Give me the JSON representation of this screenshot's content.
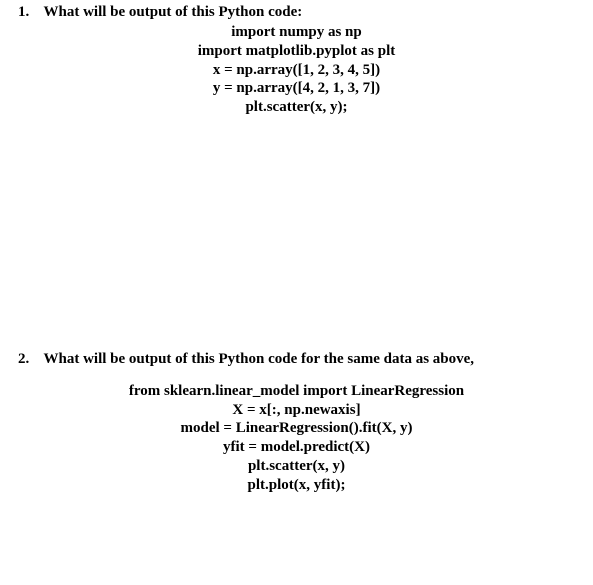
{
  "questions": {
    "q1": {
      "number": "1.",
      "prompt": "What will be output of this Python code:",
      "code": [
        "import numpy as np",
        "import matplotlib.pyplot as plt",
        "x = np.array([1, 2, 3, 4, 5])",
        "y = np.array([4, 2, 1, 3, 7])",
        "plt.scatter(x, y);"
      ]
    },
    "q2": {
      "number": "2.",
      "prompt": "What will be output of this Python code for the same data as above,",
      "code": [
        "from sklearn.linear_model import LinearRegression",
        "X = x[:, np.newaxis]",
        "model = LinearRegression().fit(X, y)",
        "yfit = model.predict(X)",
        "plt.scatter(x, y)",
        "plt.plot(x, yfit);"
      ]
    }
  }
}
